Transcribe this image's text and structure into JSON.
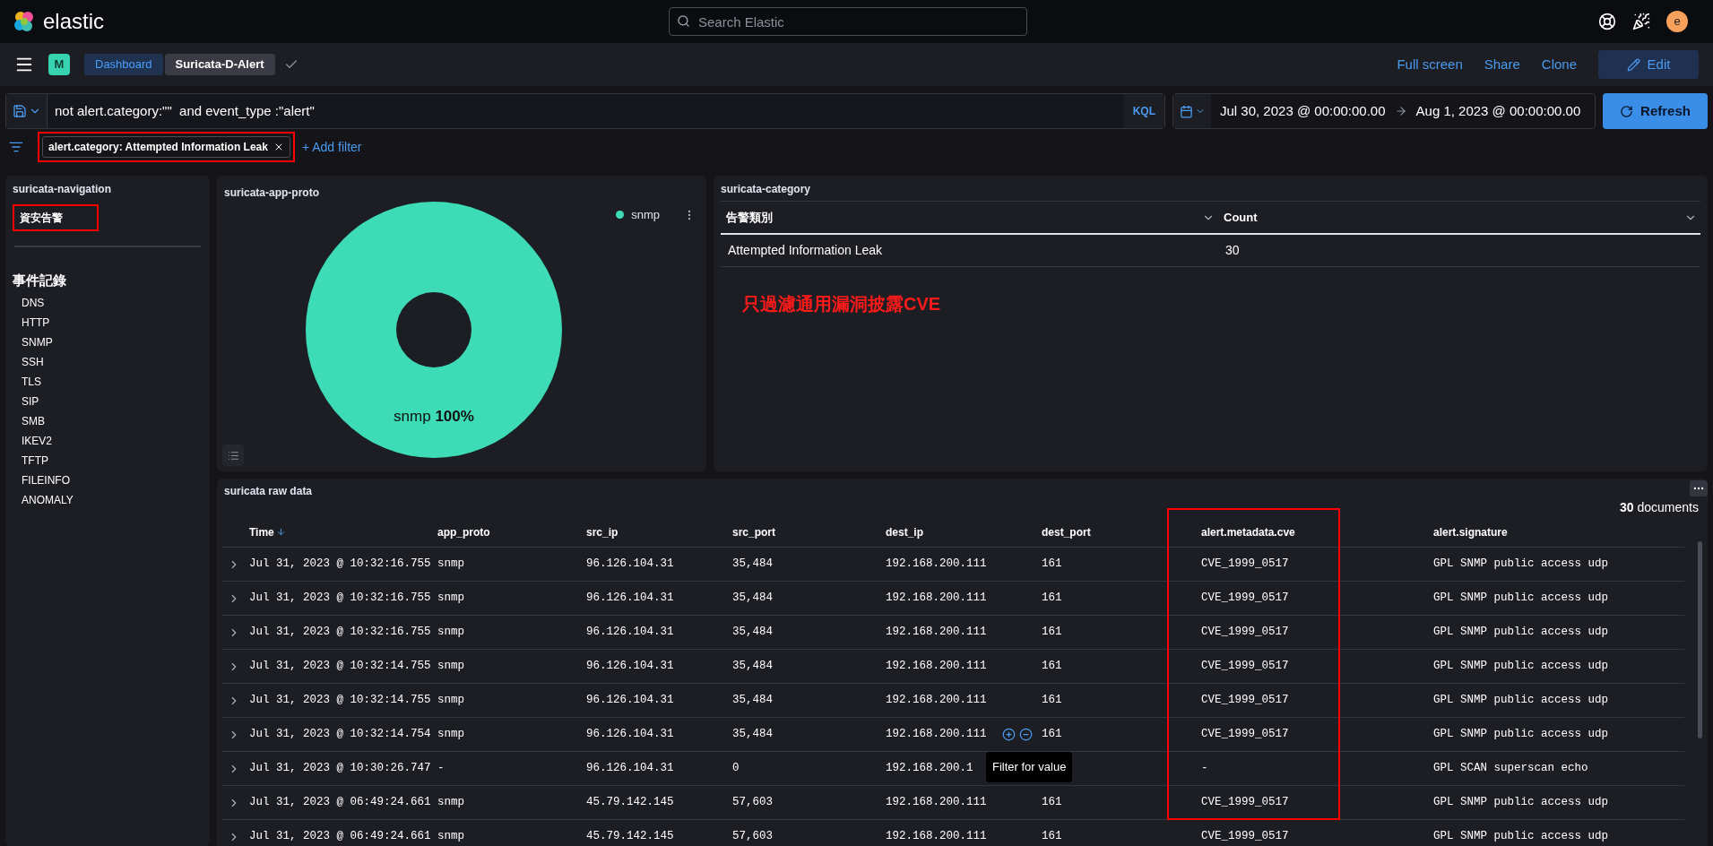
{
  "header": {
    "logo_text": "elastic",
    "search": {
      "placeholder": "Search Elastic"
    },
    "avatar": "e"
  },
  "nav_bar": {
    "space_badge": "M",
    "breadcrumbs": [
      {
        "label": "Dashboard",
        "current": false
      },
      {
        "label": "Suricata-D-Alert",
        "current": true
      }
    ],
    "actions": [
      {
        "label": "Full screen",
        "kind": "link"
      },
      {
        "label": "Share",
        "kind": "link"
      },
      {
        "label": "Clone",
        "kind": "link"
      },
      {
        "label": "Edit",
        "kind": "primary"
      }
    ]
  },
  "query_bar": {
    "query": "not alert.category:\"\"  and event_type :\"alert\"",
    "language": "KQL",
    "start": "Jul 30, 2023 @ 00:00:00.00",
    "end": "Aug 1, 2023 @ 00:00:00.00",
    "refresh": "Refresh"
  },
  "filters": {
    "pills": [
      {
        "label": "alert.category: Attempted Information Leak",
        "highlighted": true
      }
    ],
    "add": "+ Add filter"
  },
  "navigation_panel": {
    "title": "suricata-navigation",
    "alert_link": {
      "label": "資安告警",
      "highlighted": true
    },
    "section_title": "事件記錄",
    "links": [
      "DNS",
      "HTTP",
      "SNMP",
      "SSH",
      "TLS",
      "SIP",
      "SMB",
      "IKEV2",
      "TFTP",
      "FILEINFO",
      "ANOMALY"
    ]
  },
  "app_proto_panel": {
    "title": "suricata-app-proto",
    "chart_data": {
      "type": "pie",
      "categories": [
        "snmp"
      ],
      "series": [
        {
          "name": "snmp",
          "color": "#3ddbb6",
          "values": [
            100
          ]
        }
      ],
      "value_labels": [
        "100%"
      ]
    }
  },
  "category_panel": {
    "title": "suricata-category",
    "columns": [
      {
        "label": "告警類別"
      },
      {
        "label": "Count"
      }
    ],
    "rows": [
      [
        "Attempted Information Leak",
        "30"
      ]
    ],
    "note": "只過濾通用漏洞披露CVE"
  },
  "raw_data_panel": {
    "title": "suricata raw data",
    "count": "**30** documents",
    "tooltip": "Filter for value",
    "columns": [
      {
        "label": "Time",
        "sorted": true,
        "highlighted": false
      },
      {
        "label": "app_proto",
        "sorted": false,
        "highlighted": false
      },
      {
        "label": "src_ip",
        "sorted": false,
        "highlighted": false
      },
      {
        "label": "src_port",
        "sorted": false,
        "highlighted": false
      },
      {
        "label": "dest_ip",
        "sorted": false,
        "highlighted": false
      },
      {
        "label": "dest_port",
        "sorted": false,
        "highlighted": false
      },
      {
        "label": "alert.metadata.cve",
        "sorted": false,
        "highlighted": true
      },
      {
        "label": "alert.signature",
        "sorted": false,
        "highlighted": false
      }
    ],
    "rows": [
      {
        "hovered": false,
        "cells": [
          "Jul 31, 2023 @ 10:32:16.755",
          "snmp",
          "96.126.104.31",
          "35,484",
          "192.168.200.111",
          "161",
          "CVE_1999_0517",
          "GPL SNMP public access udp"
        ]
      },
      {
        "hovered": false,
        "cells": [
          "Jul 31, 2023 @ 10:32:16.755",
          "snmp",
          "96.126.104.31",
          "35,484",
          "192.168.200.111",
          "161",
          "CVE_1999_0517",
          "GPL SNMP public access udp"
        ]
      },
      {
        "hovered": false,
        "cells": [
          "Jul 31, 2023 @ 10:32:16.755",
          "snmp",
          "96.126.104.31",
          "35,484",
          "192.168.200.111",
          "161",
          "CVE_1999_0517",
          "GPL SNMP public access udp"
        ]
      },
      {
        "hovered": false,
        "cells": [
          "Jul 31, 2023 @ 10:32:14.755",
          "snmp",
          "96.126.104.31",
          "35,484",
          "192.168.200.111",
          "161",
          "CVE_1999_0517",
          "GPL SNMP public access udp"
        ]
      },
      {
        "hovered": false,
        "cells": [
          "Jul 31, 2023 @ 10:32:14.755",
          "snmp",
          "96.126.104.31",
          "35,484",
          "192.168.200.111",
          "161",
          "CVE_1999_0517",
          "GPL SNMP public access udp"
        ]
      },
      {
        "hovered": true,
        "cells": [
          "Jul 31, 2023 @ 10:32:14.754",
          "snmp",
          "96.126.104.31",
          "35,484",
          "192.168.200.111",
          "161",
          "CVE_1999_0517",
          "GPL SNMP public access udp"
        ]
      },
      {
        "hovered": false,
        "cells": [
          "Jul 31, 2023 @ 10:30:26.747",
          "-",
          "96.126.104.31",
          "0",
          "192.168.200.1",
          null,
          "-",
          "GPL SCAN superscan echo"
        ]
      },
      {
        "hovered": false,
        "cells": [
          "Jul 31, 2023 @ 06:49:24.661",
          "snmp",
          "45.79.142.145",
          "57,603",
          "192.168.200.111",
          "161",
          "CVE_1999_0517",
          "GPL SNMP public access udp"
        ]
      },
      {
        "hovered": false,
        "cells": [
          "Jul 31, 2023 @ 06:49:24.661",
          "snmp",
          "45.79.142.145",
          "57,603",
          "192.168.200.111",
          "161",
          "CVE_1999_0517",
          "GPL SNMP public access udp"
        ]
      }
    ]
  }
}
